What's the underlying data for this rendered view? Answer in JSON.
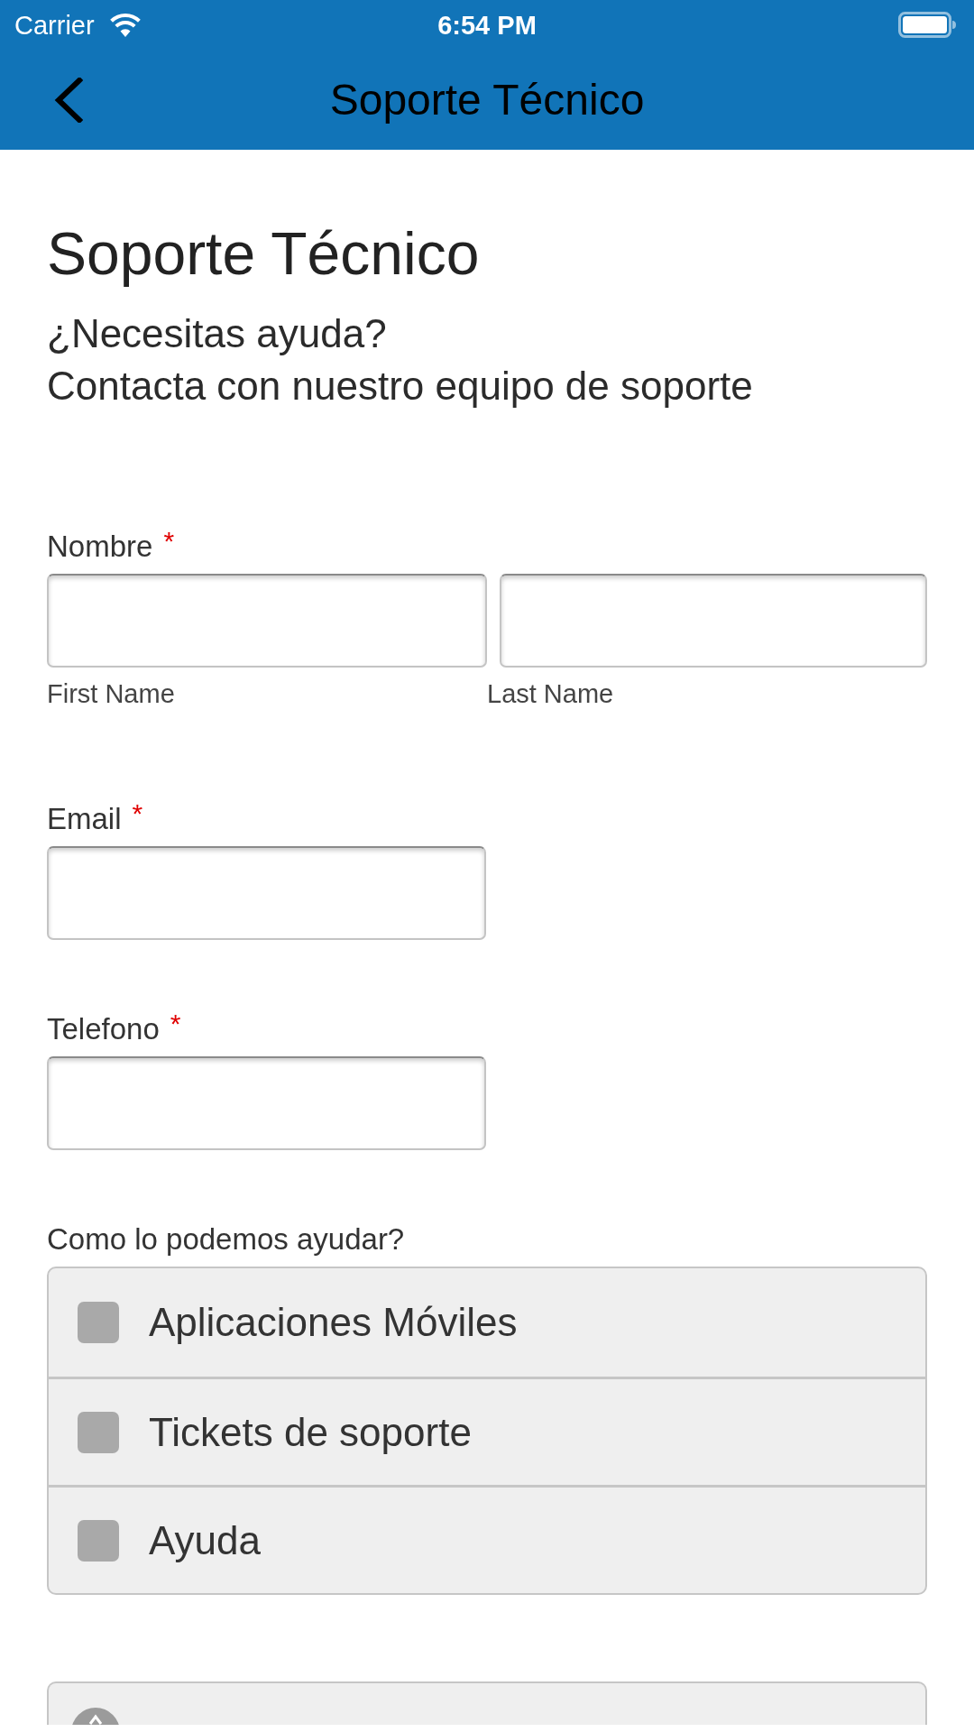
{
  "status_bar": {
    "carrier": "Carrier",
    "time": "6:54 PM"
  },
  "nav_bar": {
    "title": "Soporte Técnico"
  },
  "header": {
    "title": "Soporte Técnico",
    "subtitle_lines": [
      "¿Necesitas ayuda?",
      "Contacta con nuestro equipo de soporte"
    ]
  },
  "fields": [
    {
      "kind": "split",
      "label": "Nombre",
      "required_mark": "*",
      "inputs": [
        {
          "caption": "First Name"
        },
        {
          "caption": "Last Name"
        }
      ]
    },
    {
      "kind": "single",
      "label": "Email",
      "required_mark": "*"
    },
    {
      "kind": "single",
      "label": "Telefono",
      "required_mark": "*"
    }
  ],
  "help": {
    "label": "Como lo podemos ayudar?",
    "options": [
      {
        "label": "Aplicaciones Móviles",
        "checked": false
      },
      {
        "label": "Tickets de soporte",
        "checked": false
      },
      {
        "label": "Ayuda",
        "checked": false
      }
    ]
  },
  "actions": [
    {
      "kind": "icon_button"
    }
  ]
}
